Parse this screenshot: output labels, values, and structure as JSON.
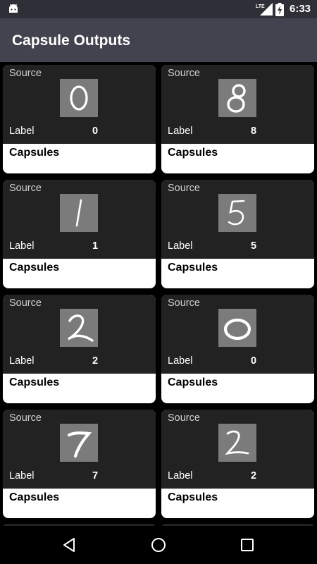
{
  "status_bar": {
    "network_badge": "LTE",
    "time": "6:33"
  },
  "app_bar": {
    "title": "Capsule Outputs"
  },
  "card_text": {
    "source": "Source",
    "label": "Label",
    "capsules": "Capsules"
  },
  "cards": [
    {
      "label_value": "0"
    },
    {
      "label_value": "8"
    },
    {
      "label_value": "1"
    },
    {
      "label_value": "5"
    },
    {
      "label_value": "2"
    },
    {
      "label_value": "0"
    },
    {
      "label_value": "7"
    },
    {
      "label_value": "2"
    }
  ],
  "nav_bar": {
    "icons": [
      "back-icon",
      "home-icon",
      "recents-icon"
    ]
  }
}
